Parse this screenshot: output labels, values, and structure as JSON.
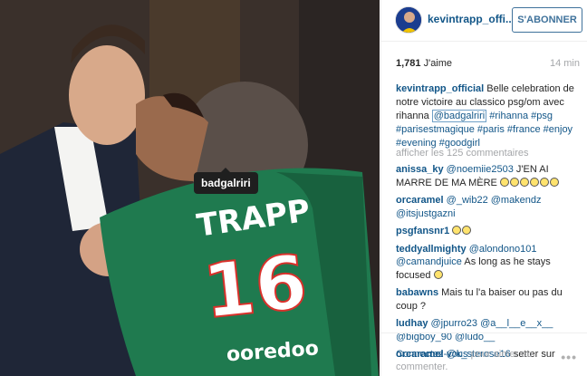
{
  "photo": {
    "tag_label": "badgalriri"
  },
  "header": {
    "username": "kevintrapp_offi...",
    "follow_label": "S'ABONNER"
  },
  "stats": {
    "likes": "1,781",
    "likes_label": "J'aime",
    "time": "14 min"
  },
  "caption": {
    "username": "kevintrapp_official",
    "text": "Belle celebration de notre victoire au classico psg/om avec rihanna",
    "mention": "@badgalriri",
    "hashtags": "#rihanna #psg #parisestmagique #paris #france #enjoy #evening #goodgirl"
  },
  "more_comments": "afficher les 125 commentaires",
  "comments": [
    {
      "user": "anissa_ky",
      "mention": "@noemiie2503",
      "text": "J'EN AI MARRE DE MA MÈRE"
    },
    {
      "user": "orcaramel",
      "mention": "@_wib22 @makendz @itsjustgazni",
      "text": ""
    },
    {
      "user": "psgfansnr1",
      "mention": "",
      "text": ""
    },
    {
      "user": "teddyallmighty",
      "mention": "@alondono101 @camandjuice",
      "text": "As long as he stays focused"
    },
    {
      "user": "babawns",
      "mention": "",
      "text": "Mais tu l'a baiser ou pas du coup ?"
    },
    {
      "user": "ludhay",
      "mention": "@jpurro23 @a__l__e__x__ @bigboy_90 @ludo__",
      "text": ""
    },
    {
      "user": "orcaramel",
      "mention": "@k_sterose16",
      "text": "setter sur"
    }
  ],
  "footer": {
    "login_link": "Connectez-vous",
    "login_text": "pour aimer ou commenter.",
    "more_icon": "ellipsis-icon"
  },
  "colors": {
    "link": "#125688",
    "follow": "#3f729b",
    "muted": "#a5a7aa",
    "jersey": "#1f7a4f"
  }
}
